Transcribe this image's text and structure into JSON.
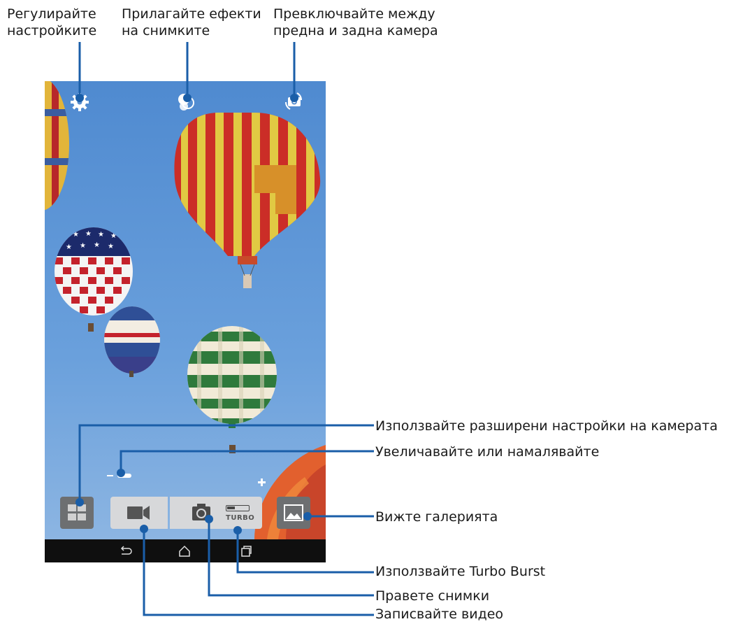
{
  "callouts": {
    "settings": {
      "line1": "Регулирайте",
      "line2": "настройките"
    },
    "effects": {
      "line1": "Прилагайте ефекти",
      "line2": "на снимките"
    },
    "switch_camera": {
      "line1": "Превключвайте между",
      "line2": "предна и задна камера"
    },
    "advanced_settings": "Използвайте разширени настройки на камерата",
    "zoom": "Увеличавайте или намалявайте",
    "gallery": "Вижте галерията",
    "turbo_burst": "Използвайте Turbo Burst",
    "take_photo": "Правете снимки",
    "record_video": "Записвайте видео"
  },
  "camera_ui": {
    "turbo_label": "TURBO",
    "zoom_minus": "−",
    "zoom_plus": "+",
    "zoom_level": 0.05,
    "turbo_enabled": false
  },
  "icons": {
    "settings": "gear-icon",
    "effects": "effects-icon",
    "switch_camera": "camera-switch-icon",
    "advanced": "grid-icon",
    "video": "video-camera-icon",
    "shutter": "camera-icon",
    "gallery": "gallery-icon",
    "back": "back-icon",
    "home": "home-icon",
    "recents": "recents-icon"
  },
  "colors": {
    "callout_line": "#1a5ea8",
    "sky": "#5a94d6",
    "navbar": "#0f0f0f",
    "button_light": "#d7d8da",
    "button_dark": "#6d6f71"
  }
}
